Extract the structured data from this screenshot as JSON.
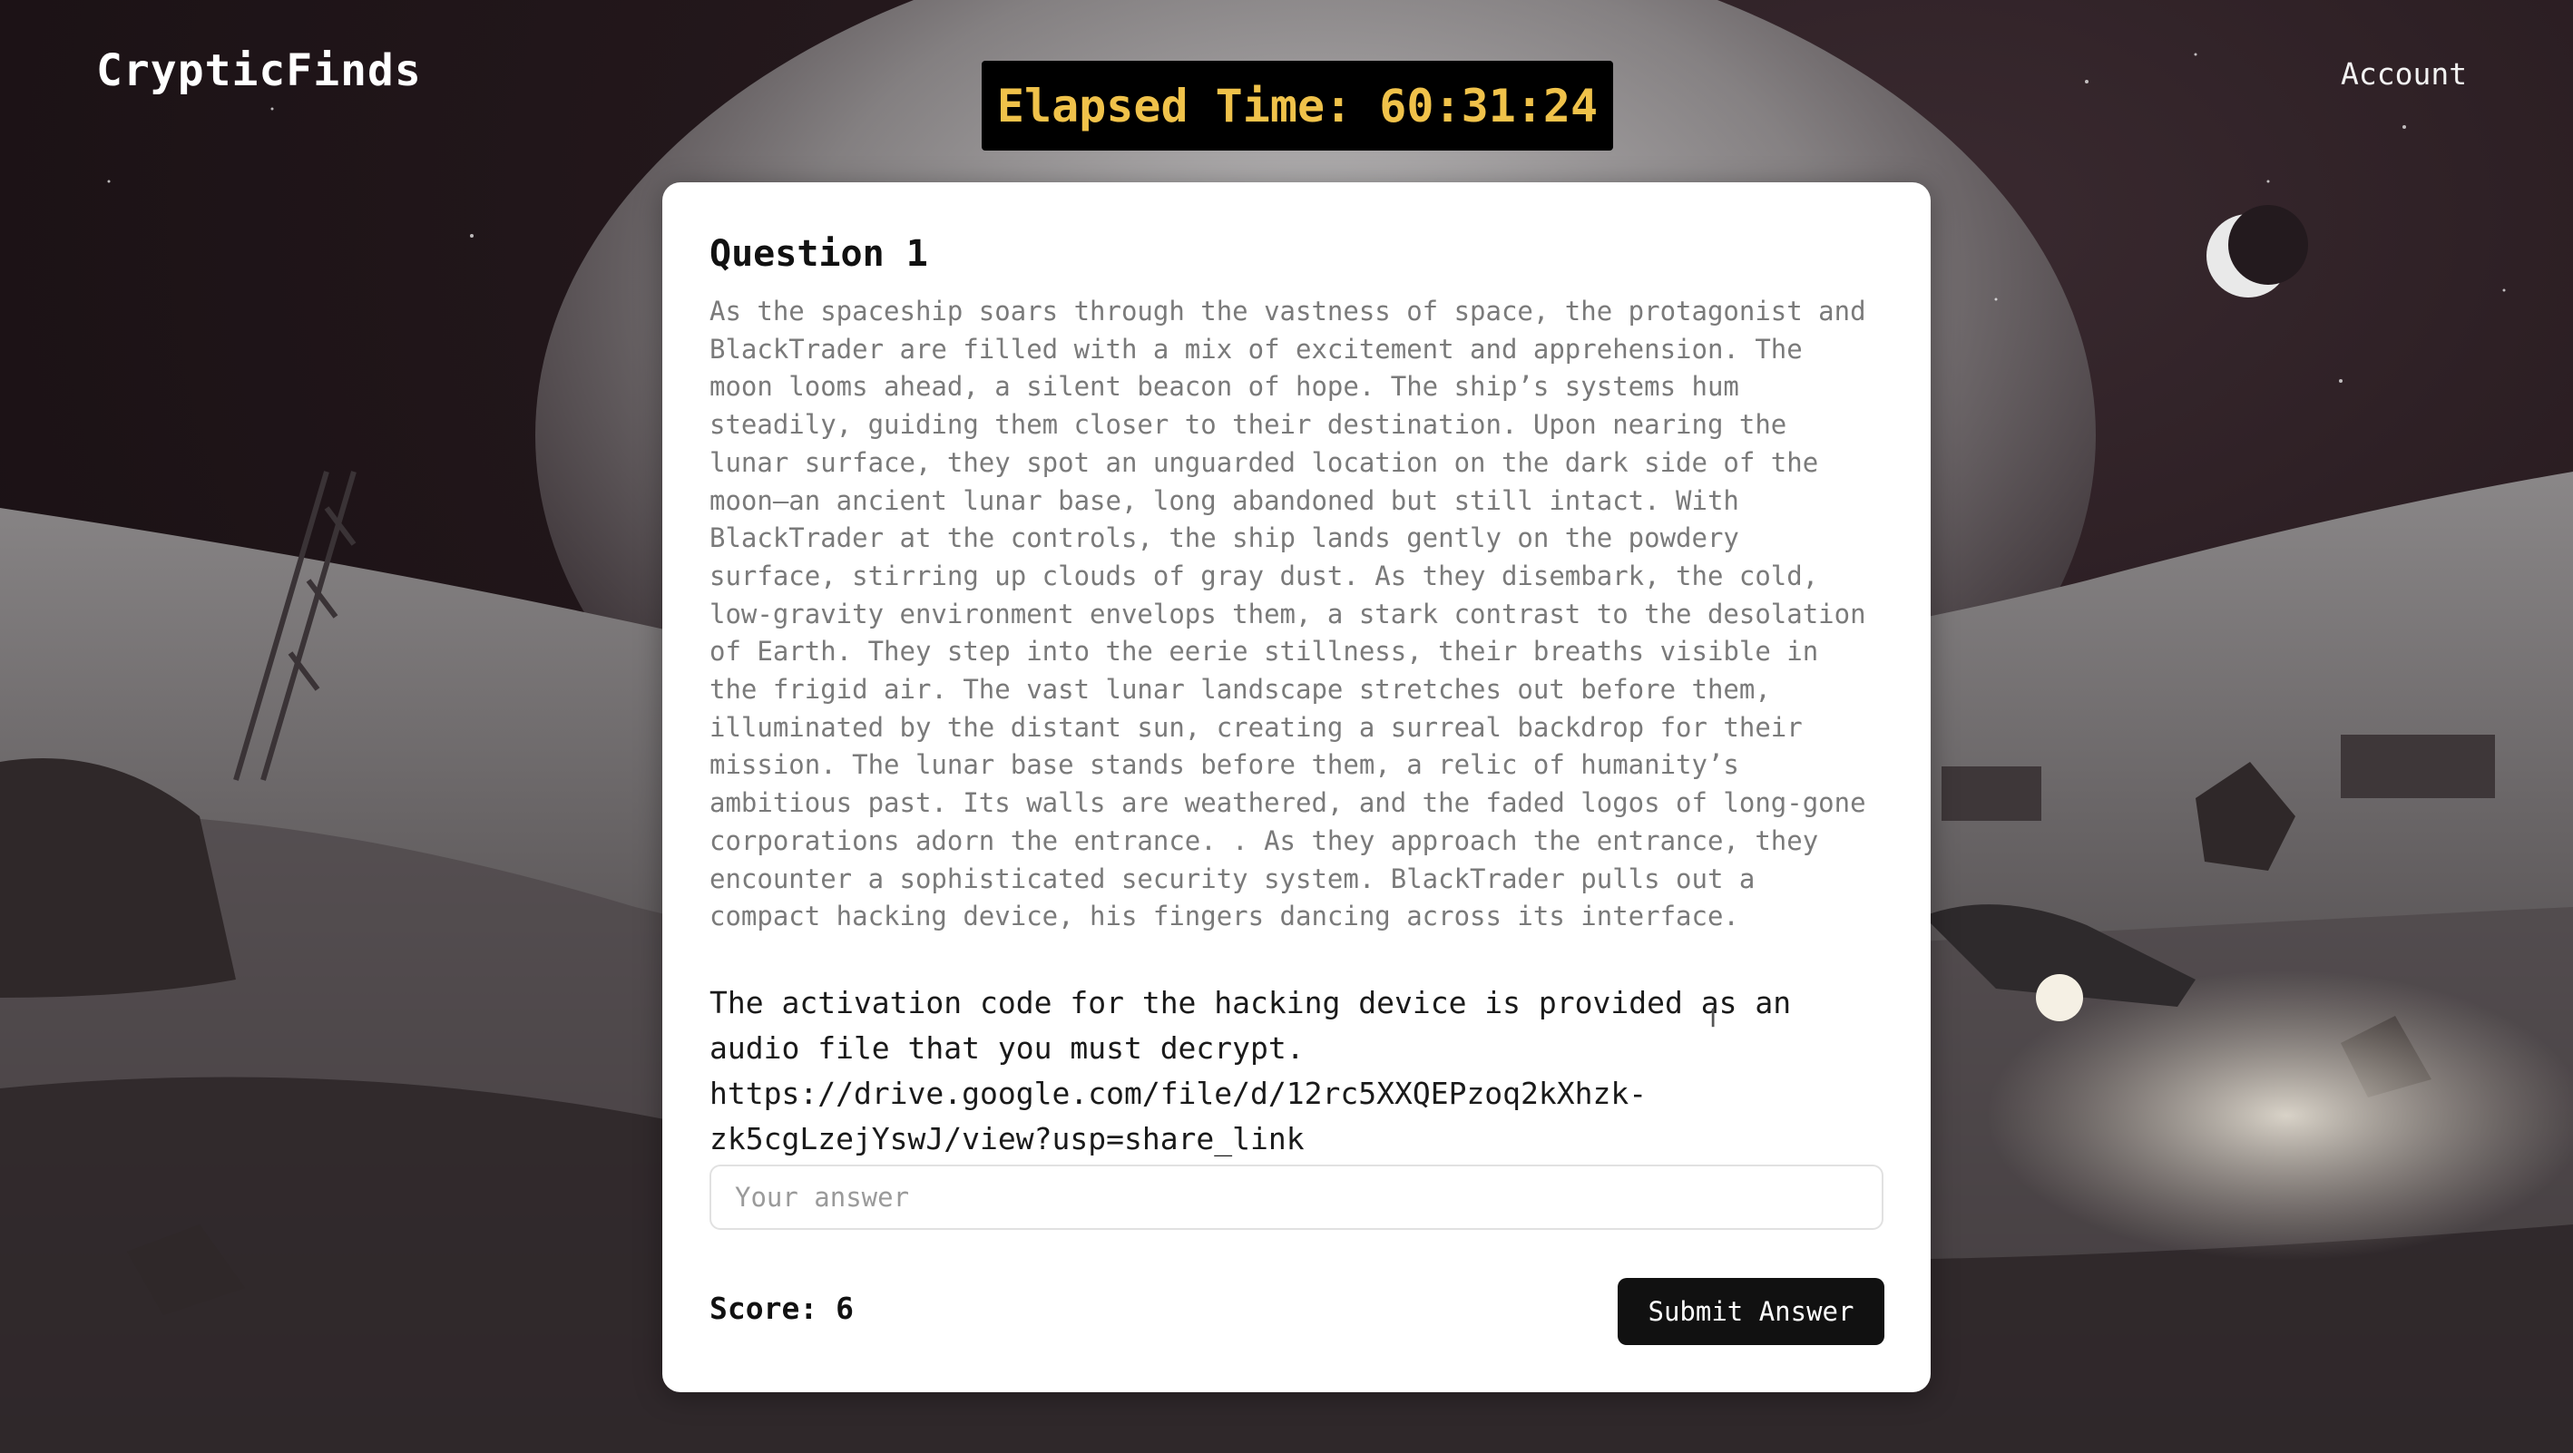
{
  "header": {
    "brand": "CrypticFinds",
    "timer": "Elapsed Time: 60:31:24",
    "account_label": "Account"
  },
  "question": {
    "title": "Question 1",
    "story": "As the spaceship soars through the vastness of space, the protagonist and\nBlackTrader are filled with a mix of excitement and apprehension. The\nmoon looms ahead, a silent beacon of hope. The ship’s systems hum\nsteadily, guiding them closer to their destination. Upon nearing the\nlunar surface, they spot an unguarded location on the dark side of the\nmoon—an ancient lunar base, long abandoned but still intact. With\nBlackTrader at the controls, the ship lands gently on the powdery\nsurface, stirring up clouds of gray dust. As they disembark, the cold,\nlow-gravity environment envelops them, a stark contrast to the desolation\nof Earth. They step into the eerie stillness, their breaths visible in\nthe frigid air. The vast lunar landscape stretches out before them,\nilluminated by the distant sun, creating a surreal backdrop for their\nmission. The lunar base stands before them, a relic of humanity’s\nambitious past. Its walls are weathered, and the faded logos of long-gone\ncorporations adorn the entrance. . As they approach the entrance, they\nencounter a sophisticated security system. BlackTrader pulls out a\ncompact hacking device, his fingers dancing across its interface.",
    "prompt": "The activation code for the hacking device is provided as an\naudio file that you must decrypt.\nhttps://drive.google.com/file/d/12rc5XXQEPzoq2kXhzk-\nzk5cgLzejYswJ/view?usp=share_link",
    "answer_placeholder": "Your answer",
    "answer_value": ""
  },
  "footer": {
    "score": "Score: 6",
    "submit_label": "Submit Answer"
  },
  "colors": {
    "timer_text": "#f0c24a",
    "button_bg": "#111111",
    "card_bg": "#ffffff"
  }
}
